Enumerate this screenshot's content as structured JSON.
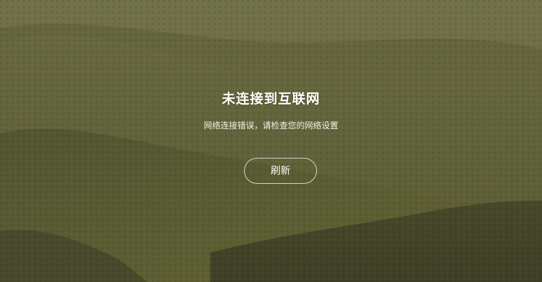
{
  "error": {
    "title": "未连接到互联网",
    "message": "网络连接错误，请检查您的网络设置",
    "refresh_label": "刷新"
  },
  "colors": {
    "text": "#ffffff",
    "background_tone": "#6b6a3c"
  }
}
